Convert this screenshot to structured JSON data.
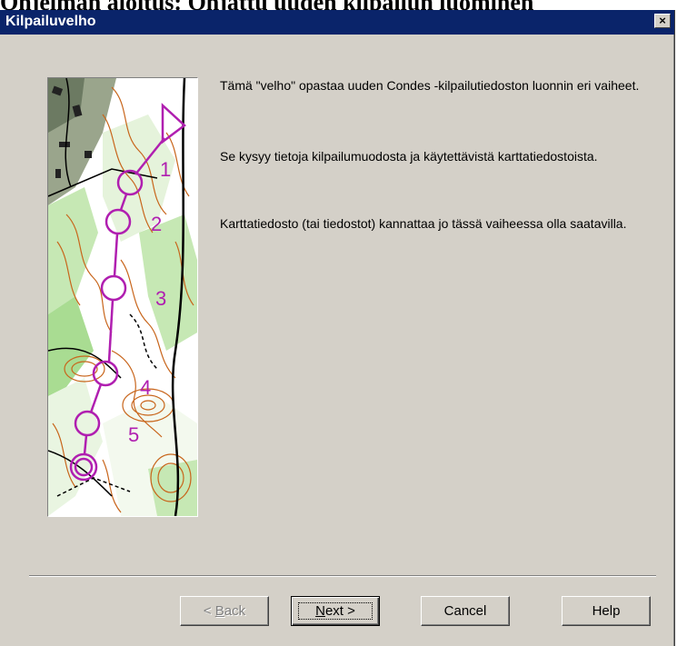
{
  "background_heading": "Ohjelman aloitus: Ohjattu uuden kilpailun luominen",
  "window": {
    "title": "Kilpailuvelho",
    "close_label": "×"
  },
  "description": {
    "paragraph1": "Tämä \"velho\" opastaa uuden Condes -kilpailutiedoston luonnin eri vaiheet.",
    "paragraph2": "Se kysyy tietoja kilpailumuodosta ja käytettävistä karttatiedostoista.",
    "paragraph3": "Karttatiedosto (tai tiedostot) kannattaa jo tässä vaiheessa olla saatavilla."
  },
  "map": {
    "control_numbers": [
      "1",
      "2",
      "3",
      "4",
      "5"
    ],
    "course_color": "#b01fb0",
    "contour_color": "#c8651b",
    "forest_color": "#c6e8b4"
  },
  "buttons": {
    "back": {
      "label_prefix": "< ",
      "label_accel": "B",
      "label_rest": "ack",
      "enabled": false
    },
    "next": {
      "label_accel": "N",
      "label_rest": "ext >",
      "default": true
    },
    "cancel": {
      "label": "Cancel"
    },
    "help": {
      "label": "Help"
    }
  }
}
